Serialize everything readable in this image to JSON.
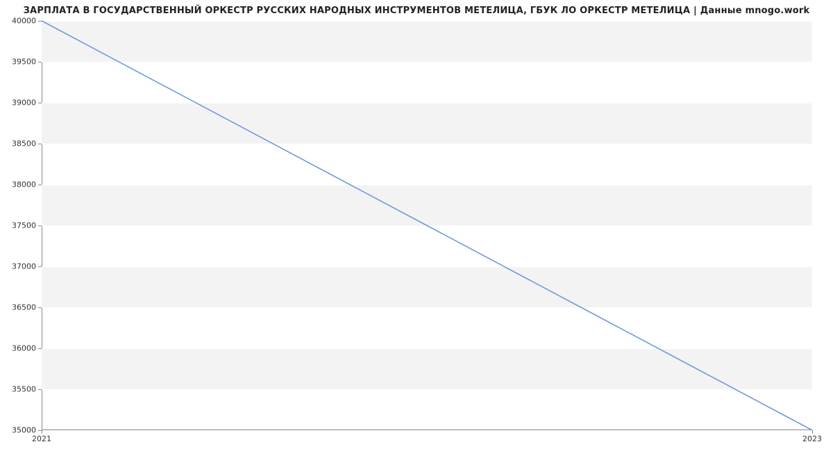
{
  "chart_data": {
    "type": "line",
    "title": "ЗАРПЛАТА В ГОСУДАРСТВЕННЫЙ ОРКЕСТР РУССКИХ НАРОДНЫХ ИНСТРУМЕНТОВ МЕТЕЛИЦА, ГБУК ЛО ОРКЕСТР МЕТЕЛИЦА | Данные mnogo.work",
    "xlabel": "",
    "ylabel": "",
    "x": [
      2021,
      2023
    ],
    "series": [
      {
        "name": "salary",
        "values": [
          40000,
          35000
        ],
        "color": "#6f98db"
      }
    ],
    "x_ticks": [
      2021,
      2023
    ],
    "y_ticks": [
      35000,
      35500,
      36000,
      36500,
      37000,
      37500,
      38000,
      38500,
      39000,
      39500,
      40000
    ],
    "xlim": [
      2021,
      2023
    ],
    "ylim": [
      35000,
      40000
    ],
    "grid": true,
    "legend": false,
    "band_color": "#f3f3f3"
  }
}
